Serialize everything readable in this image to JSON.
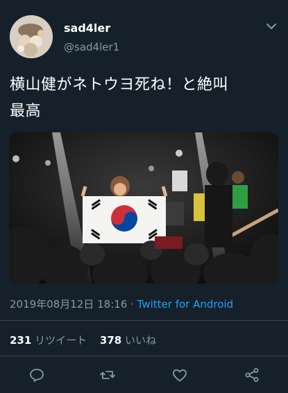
{
  "tweet": {
    "display_name": "sad4ler",
    "handle": "@sad4ler1",
    "text": "横山健がネトウヨ死ね！と絶叫\n最高",
    "timestamp": "2019年08月12日 18:16",
    "separator": " · ",
    "source": "Twitter for Android",
    "retweet_count": "231",
    "retweet_label": "リツイート",
    "like_count": "378",
    "like_label": "いいね"
  },
  "icons": {
    "menu": "chevron-down-icon",
    "reply": "reply-icon",
    "retweet": "retweet-icon",
    "like": "heart-icon",
    "share": "share-icon"
  },
  "colors": {
    "background": "#15202b",
    "secondary_text": "#8899a6",
    "link": "#1da1f2",
    "divider": "#38444d"
  }
}
